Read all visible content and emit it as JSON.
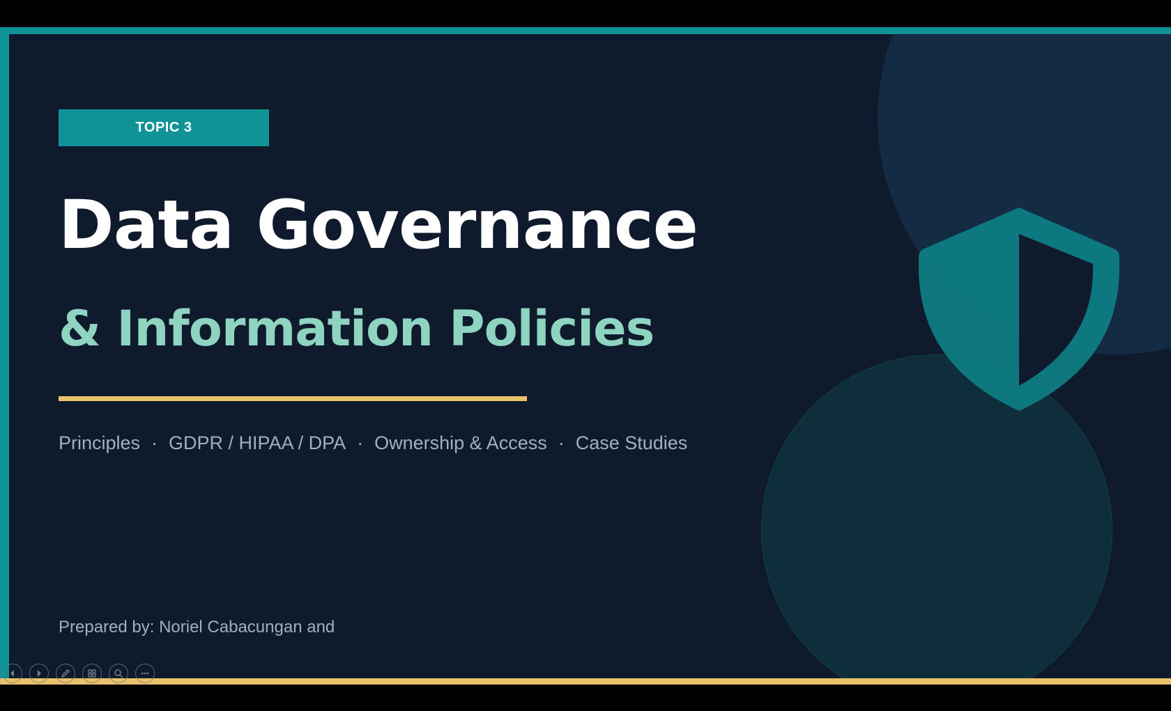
{
  "slide": {
    "badge": "TOPIC 3",
    "title": "Data Governance",
    "subtitle": "& Information Policies",
    "topics": [
      "Principles",
      "GDPR / HIPAA / DPA",
      "Ownership & Access",
      "Case Studies"
    ],
    "topic_separator": "·",
    "prepared_by": "Prepared by: Noriel Cabacungan and"
  },
  "controls": [
    {
      "name": "previous-slide-button",
      "icon": "arrow-left-icon"
    },
    {
      "name": "next-slide-button",
      "icon": "arrow-right-icon"
    },
    {
      "name": "pen-tool-button",
      "icon": "pen-icon"
    },
    {
      "name": "see-all-slides-button",
      "icon": "slides-grid-icon"
    },
    {
      "name": "zoom-button",
      "icon": "magnifier-icon"
    },
    {
      "name": "more-options-button",
      "icon": "ellipsis-icon"
    }
  ],
  "colors": {
    "background": "#0f1b2d",
    "teal": "#0f9396",
    "gold": "#e8c16a",
    "mint": "#8fd3c1",
    "muted": "#9fb0c2"
  }
}
